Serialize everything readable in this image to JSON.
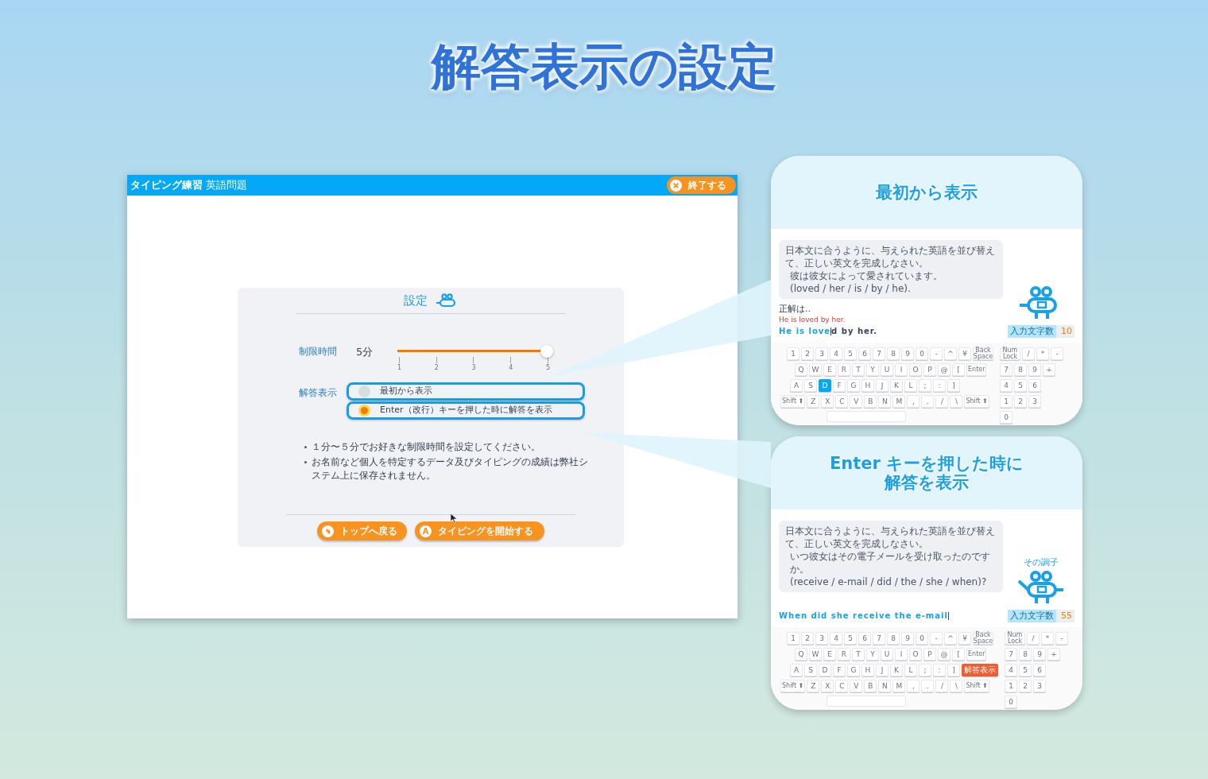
{
  "page_title": "解答表示の設定",
  "app": {
    "title": "タイピング練習",
    "subtitle": "英語問題",
    "quit_button": "終了する",
    "settings": {
      "heading": "設定",
      "time_label": "制限時間",
      "time_value": "5分",
      "time_slider": {
        "level": 1.0,
        "ticks": [
          "1",
          "2",
          "3",
          "4",
          "5"
        ]
      },
      "answer_label": "解答表示",
      "answer_options": [
        {
          "label": "最初から表示",
          "selected": false
        },
        {
          "label": "Enter（改行）キーを押した時に解答を表示",
          "selected": true
        }
      ],
      "notes": [
        "１分〜５分でお好きな制限時間を設定してください。",
        "お名前など個人を特定するデータ及びタイピングの成績は弊社システム上に保存されません。"
      ],
      "back_button": "トップへ戻る",
      "start_button": "タイピングを開始する",
      "start_icon_letter": "A"
    }
  },
  "cards": [
    {
      "title": [
        "最初から表示"
      ],
      "prompt": [
        "日本文に合うように、与えられた英語を並び替えて、正しい英文を完成しなさい。",
        "彼は彼女によって愛されています。",
        "(loved / her / is / by / he)."
      ],
      "answer_caption": "正解は..",
      "answer": "He is loved by her.",
      "typed": "He is love",
      "remaining": "d by her.",
      "counter_label": "入力文字数",
      "counter_value": "10",
      "keyboard": {
        "rows": [
          [
            "1",
            "2",
            "3",
            "4",
            "5",
            "6",
            "7",
            "8",
            "9",
            "0",
            "-",
            "^",
            "¥",
            "Back Space"
          ],
          [
            "Q",
            "W",
            "E",
            "R",
            "T",
            "Y",
            "U",
            "I",
            "O",
            "P",
            "@",
            "[",
            "Enter"
          ],
          [
            "A",
            "S",
            {
              "label": "D",
              "kind": "highlighted"
            },
            "F",
            "G",
            "H",
            "J",
            "K",
            "L",
            ";",
            ":",
            "]"
          ],
          [
            "Shift ⬆",
            "Z",
            "X",
            "C",
            "V",
            "B",
            "N",
            "M",
            ",",
            ".",
            "/",
            "\\",
            "Shift ⬆"
          ]
        ],
        "numpad": [
          [
            "Num Lock",
            "/",
            "*",
            "-"
          ],
          [
            "7",
            "8",
            "9",
            "+"
          ],
          [
            "4",
            "5",
            "6"
          ],
          [
            "1",
            "2",
            "3"
          ],
          [
            "0"
          ]
        ]
      }
    },
    {
      "title": [
        "Enter キーを押した時に",
        "解答を表示"
      ],
      "mascot_speech": "その調子",
      "prompt": [
        "日本文に合うように、与えられた英語を並び替えて、正しい英文を完成しなさい。",
        "いつ彼女はその電子メールを受け取ったのですか。",
        "(receive / e-mail / did / the / she / when)?"
      ],
      "typed": "When did she receive the e-mail",
      "counter_label": "入力文字数",
      "counter_value": "55",
      "keyboard": {
        "rows": [
          [
            "1",
            "2",
            "3",
            "4",
            "5",
            "6",
            "7",
            "8",
            "9",
            "0",
            "-",
            "^",
            "¥",
            "Back Space"
          ],
          [
            "Q",
            "W",
            "E",
            "R",
            "T",
            "Y",
            "U",
            "I",
            "O",
            "P",
            "@",
            "[",
            "Enter"
          ],
          [
            "A",
            "S",
            "D",
            "F",
            "G",
            "H",
            "J",
            "K",
            "L",
            ";",
            ":",
            "]",
            {
              "label": "解答表示",
              "kind": "answer"
            }
          ],
          [
            "Shift ⬆",
            "Z",
            "X",
            "C",
            "V",
            "B",
            "N",
            "M",
            ",",
            ".",
            "/",
            "\\",
            "Shift ⬆"
          ]
        ],
        "numpad": [
          [
            "Num Lock",
            "/",
            "*",
            "-"
          ],
          [
            "7",
            "8",
            "9",
            "+"
          ],
          [
            "4",
            "5",
            "6"
          ],
          [
            "1",
            "2",
            "3"
          ],
          [
            "0"
          ]
        ]
      }
    }
  ]
}
